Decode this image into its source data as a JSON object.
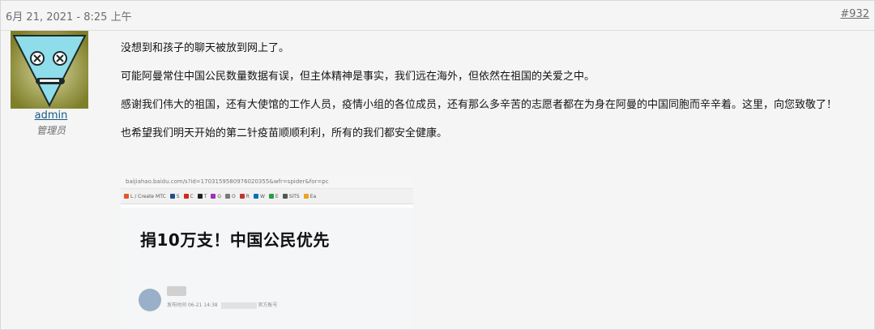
{
  "post": {
    "date": "6月 21, 2021 - 8:25 上午",
    "number": "#932"
  },
  "user": {
    "name": "admin",
    "title": "管理员"
  },
  "message": {
    "paragraphs": [
      "没想到和孩子的聊天被放到网上了。",
      "可能阿曼常住中国公民数量数据有误，但主体精神是事实，我们远在海外，但依然在祖国的关爱之中。",
      "感谢我们伟大的祖国，还有大使馆的工作人员，疫情小组的各位成员，还有那么多辛苦的志愿者都在为身在阿曼的中国同胞而辛辛着。这里，向您致敬了！",
      "也希望我们明天开始的第二针疫苗顺顺利利，所有的我们都安全健康。"
    ]
  },
  "embedded_screenshot": {
    "url": "baijiahao.baidu.com/s?id=1703159580976020355&wfr=spider&for=pc",
    "bookmarks": [
      "L / Create MTC",
      "S",
      "C",
      "T",
      "G",
      "O",
      "R",
      "W",
      "E",
      "SITS",
      "Ea"
    ],
    "article_title": "捐10万支！中国公民优先",
    "meta_prefix": "发布时间",
    "meta_date": "06-21",
    "meta_time": "14:38",
    "meta_suffix": "官方账号"
  },
  "colors": {
    "link": "#185886",
    "muted": "#6d6d6d",
    "avatar_face": "#8fdcea",
    "avatar_bg": "#8e8e3c"
  }
}
